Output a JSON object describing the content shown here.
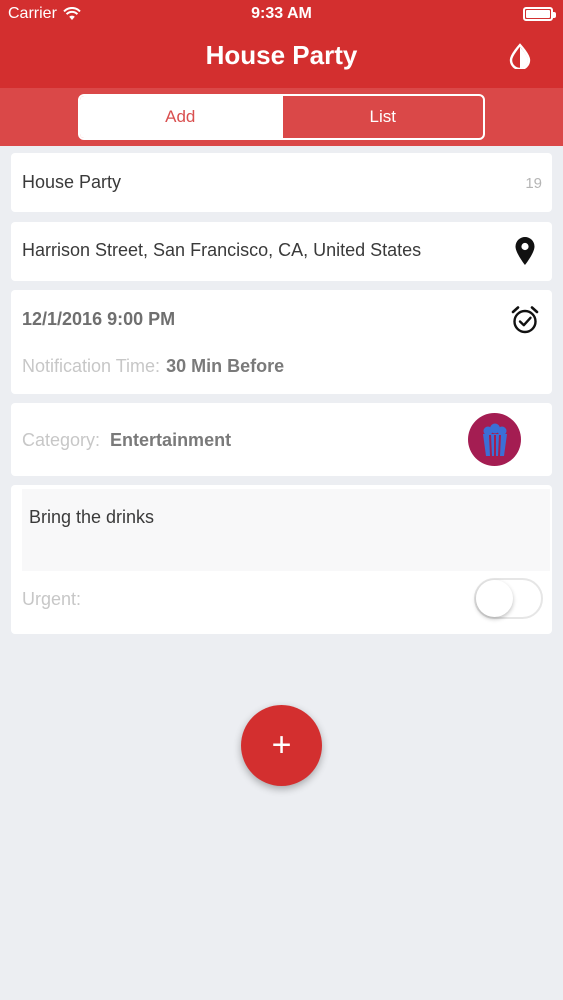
{
  "status_bar": {
    "carrier": "Carrier",
    "time": "9:33 AM"
  },
  "nav": {
    "title": "House Party",
    "theme_icon": "drop-icon"
  },
  "segments": {
    "add_label": "Add",
    "list_label": "List",
    "selected": "Add"
  },
  "form": {
    "title_value": "House Party",
    "title_count": "19",
    "location_value": "Harrison Street, San Francisco, CA, United States",
    "location_icon": "map-pin-icon",
    "date_value": "12/1/2016 9:00 PM",
    "alarm_icon": "alarm-clock-icon",
    "notification_label": "Notification Time:",
    "notification_value": "30 Min Before",
    "category_label": "Category:",
    "category_value": "Entertainment",
    "category_icon": "popcorn-icon",
    "notes_value": "Bring the drinks",
    "urgent_label": "Urgent:",
    "urgent_on": false
  },
  "fab": {
    "symbol": "+"
  },
  "colors": {
    "primary": "#d32f2f",
    "segment_bar": "#da4848",
    "category_badge": "#a41d52",
    "popcorn_blue": "#3b6fd6",
    "background": "#eceef2"
  }
}
